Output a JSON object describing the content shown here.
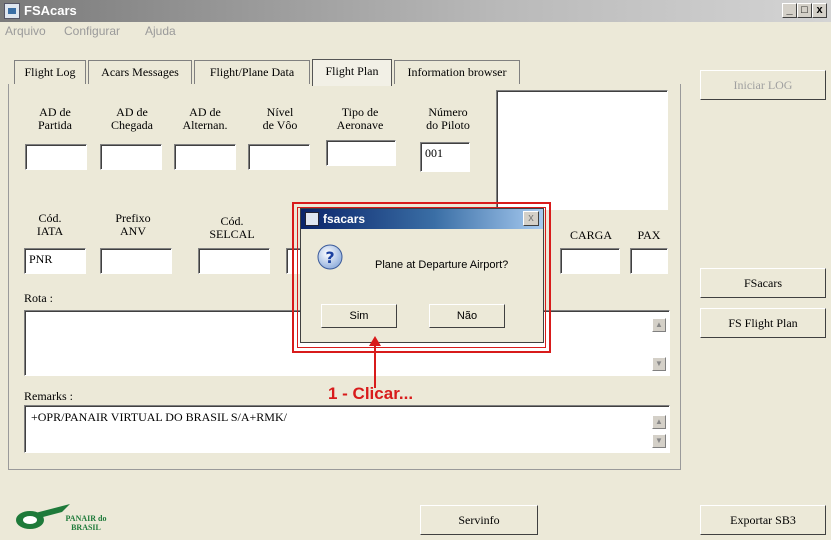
{
  "window": {
    "title": "FSAcars",
    "minimize": "_",
    "maximize": "□",
    "close": "x"
  },
  "menu": [
    "Arquivo",
    "Configurar",
    "Ajuda"
  ],
  "tabs": [
    "Flight Log",
    "Acars Messages",
    "Flight/Plane Data",
    "Flight Plan",
    "Information browser"
  ],
  "active_tab": "Flight Plan",
  "fields_row1": [
    {
      "label": "AD de\nPartida",
      "value": ""
    },
    {
      "label": "AD de\nChegada",
      "value": ""
    },
    {
      "label": "AD de\nAlternan.",
      "value": ""
    },
    {
      "label": "Nível\nde Vôo",
      "value": ""
    },
    {
      "label": "Tipo de\nAeronave",
      "value": ""
    },
    {
      "label": "Número\ndo Piloto",
      "value": "001"
    }
  ],
  "fields_row2": [
    {
      "label": "Cód.\nIATA",
      "value": "PNR"
    },
    {
      "label": "Prefixo\nANV",
      "value": ""
    },
    {
      "label": "Cód.\nSELCAL",
      "value": ""
    },
    {
      "label": "CARGA",
      "value": ""
    },
    {
      "label": "PAX",
      "value": ""
    }
  ],
  "rota_label": "Rota :",
  "rota_value": "",
  "remarks_label": "Remarks :",
  "remarks_value": "+OPR/PANAIR VIRTUAL DO BRASIL S/A+RMK/",
  "right_buttons": {
    "iniciar_log": "Iniciar LOG",
    "fscars": "FSacars",
    "fs_flight_plan": "FS Flight Plan",
    "exportar": "Exportar SB3"
  },
  "servinfo_button": "Servinfo",
  "logo_text": "PANAIR do BRASIL",
  "dialog": {
    "title": "fsacars",
    "close": "x",
    "message": "Plane at Departure Airport?",
    "yes": "Sim",
    "no": "Não"
  },
  "annotation": "1 - Clicar...",
  "colors": {
    "annotation_red": "#d81b1b",
    "dialog_title_start": "#0a246a",
    "logo_green": "#1e7a3a"
  }
}
